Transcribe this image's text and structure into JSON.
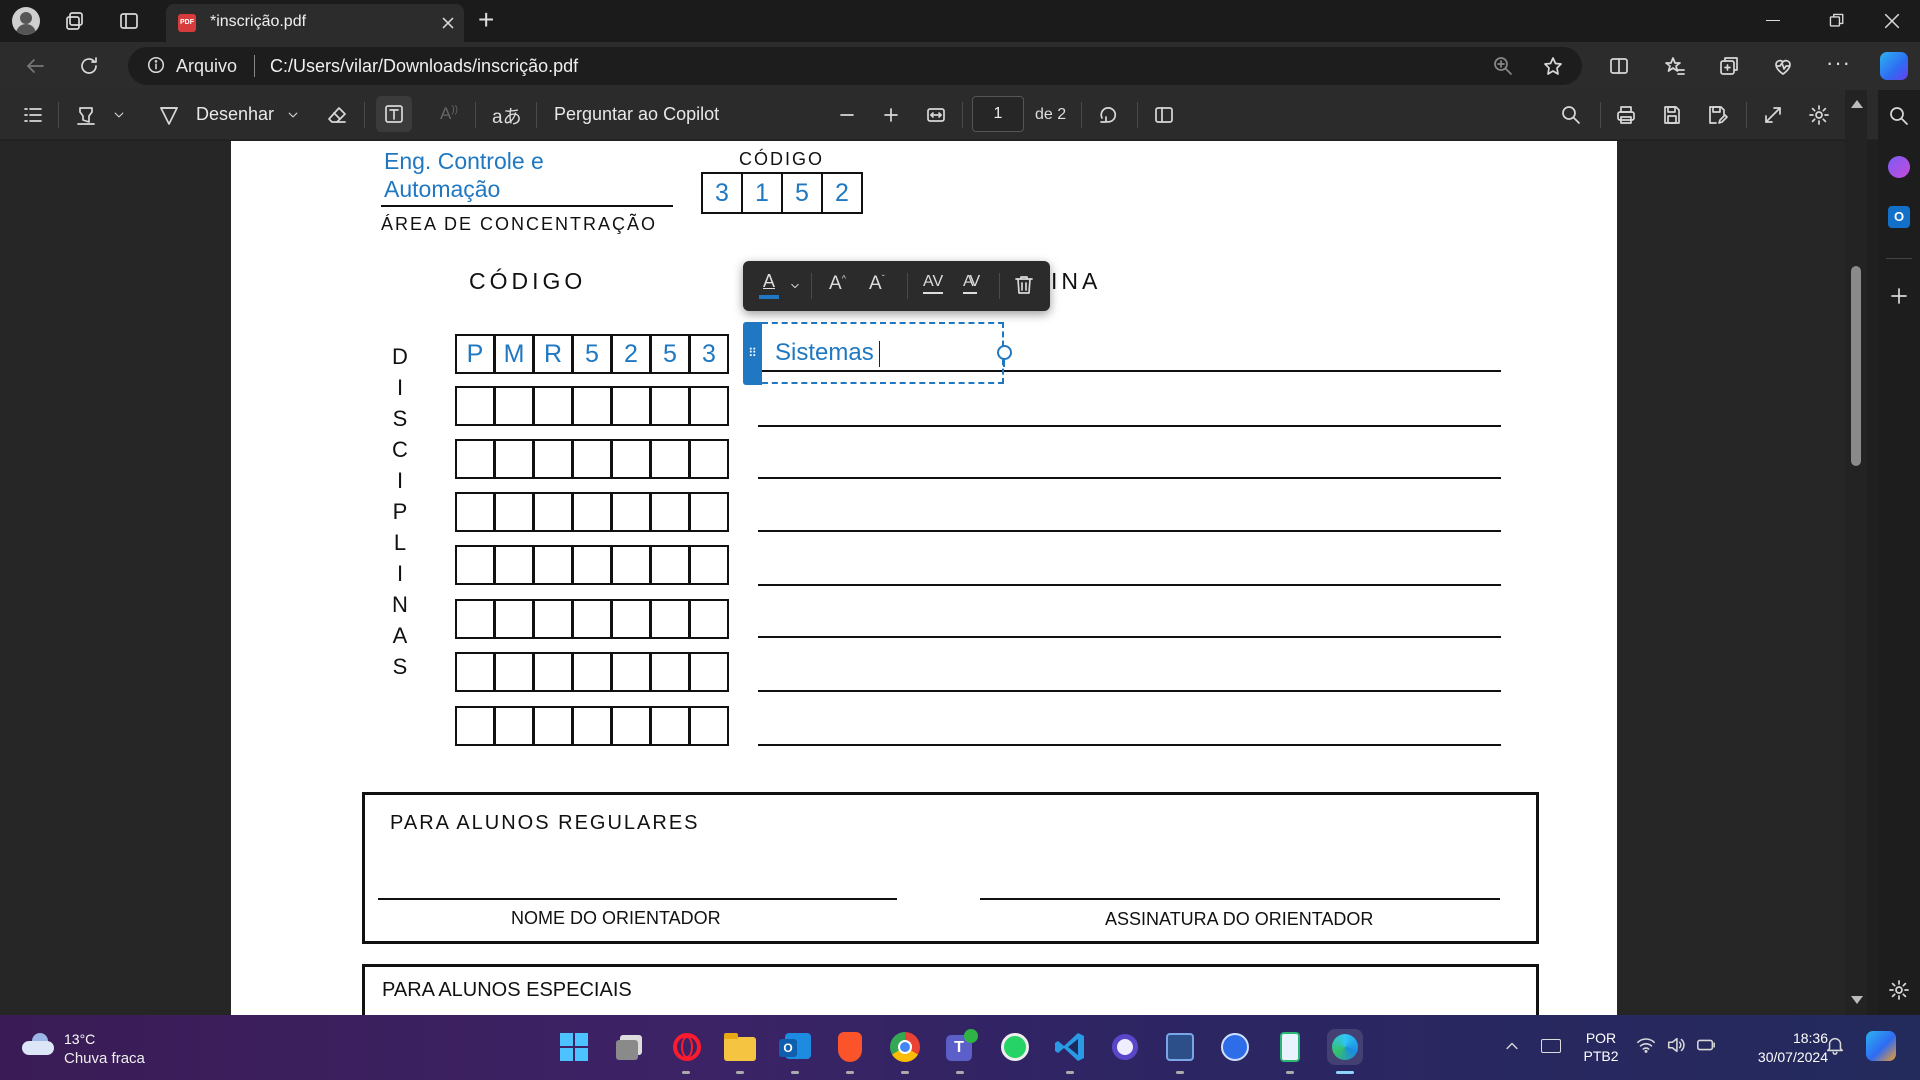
{
  "browser": {
    "tab_title": "*inscrição.pdf",
    "new_tab": "+",
    "security_label": "Arquivo",
    "url": "C:/Users/vilar/Downloads/inscrição.pdf"
  },
  "pdf_toolbar": {
    "draw_label": "Desenhar",
    "copilot_label": "Perguntar ao Copilot",
    "page_current": "1",
    "page_total": "de 2"
  },
  "form": {
    "area_value_line1": "Eng. Controle e",
    "area_value_line2": "Automação",
    "area_label": "ÁREA DE CONCENTRAÇÃO",
    "codigo_top_label": "CÓDIGO",
    "codigo_top_digits": [
      "3",
      "1",
      "5",
      "2"
    ],
    "codigo_label": "CÓDIGO",
    "disciplina_label_visible": "INA",
    "disciplinas_vertical": [
      "D",
      "I",
      "S",
      "C",
      "I",
      "P",
      "L",
      "I",
      "N",
      "A",
      "S"
    ],
    "first_code": [
      "P",
      "M",
      "R",
      "5",
      "2",
      "5",
      "3"
    ],
    "text_box_value": "Sistemas",
    "regulares_title": "PARA ALUNOS REGULARES",
    "nome_orientador": "NOME DO ORIENTADOR",
    "assinatura_orientador": "ASSINATURA DO ORIENTADOR",
    "especiais_title": "PARA ALUNOS ESPECIAIS"
  },
  "taskbar": {
    "weather_temp": "13°C",
    "weather_desc": "Chuva fraca",
    "lang_line1": "POR",
    "lang_line2": "PTB2",
    "time": "18:36",
    "date": "30/07/2024"
  },
  "colors": {
    "accent": "#1f78c1",
    "page_bg": "#ffffff",
    "chrome_bg": "#2b2b2b"
  }
}
